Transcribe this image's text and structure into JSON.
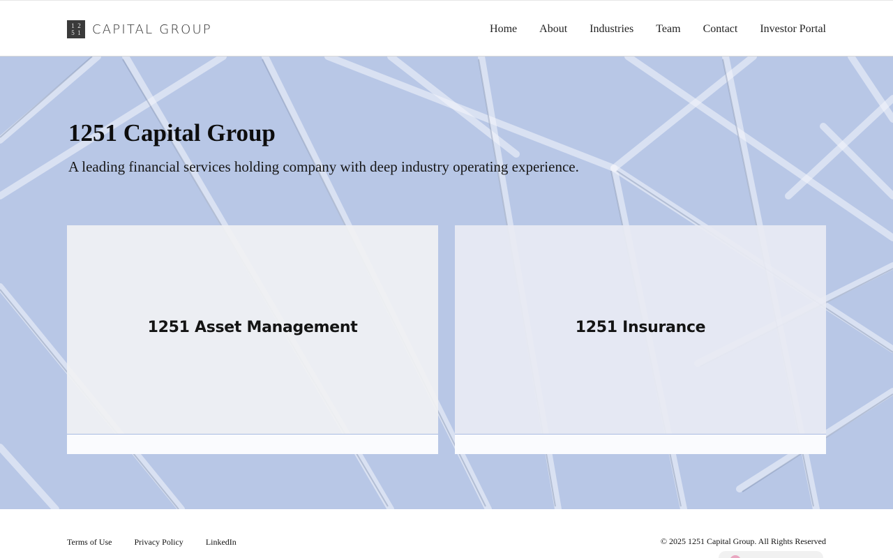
{
  "header": {
    "logo_mark": [
      "1",
      "2",
      "5",
      "1"
    ],
    "logo_text": "CAPITAL GROUP",
    "nav": [
      {
        "label": "Home"
      },
      {
        "label": "About"
      },
      {
        "label": "Industries"
      },
      {
        "label": "Team"
      },
      {
        "label": "Contact"
      },
      {
        "label": "Investor Portal"
      }
    ]
  },
  "hero": {
    "title": "1251 Capital Group",
    "subtitle": "A leading financial services holding company with deep industry operating experience.",
    "background_color": "#b8c7e6"
  },
  "cards": [
    {
      "label": "1251 Asset Management"
    },
    {
      "label": "1251 Insurance"
    }
  ],
  "footer": {
    "links": [
      {
        "label": "Terms of Use"
      },
      {
        "label": "Privacy Policy"
      },
      {
        "label": "LinkedIn"
      }
    ],
    "copyright": "© 2025 1251 Capital Group. All Rights Reserved"
  }
}
